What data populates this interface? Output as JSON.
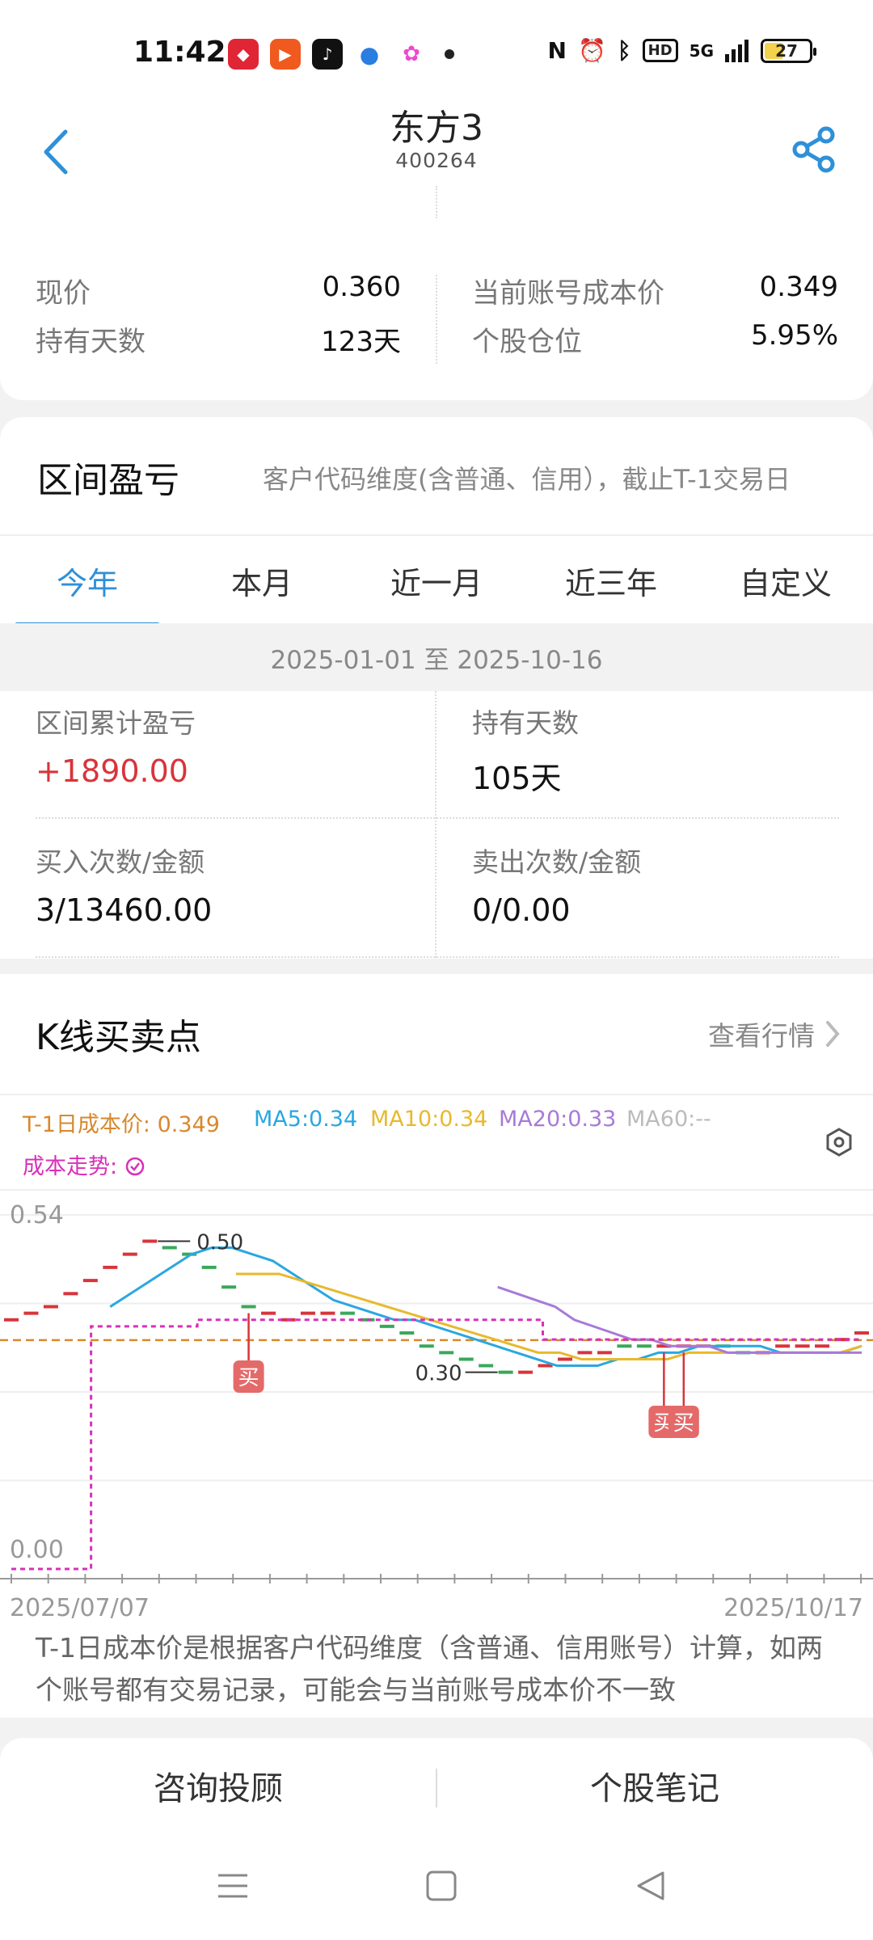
{
  "status": {
    "time": "11:42",
    "battery": "27",
    "network": "5G",
    "hd": "HD"
  },
  "header": {
    "title": "东方3",
    "code": "400264"
  },
  "summary": {
    "price_label": "现价",
    "price_value": "0.360",
    "cost_label": "当前账号成本价",
    "cost_value": "0.349",
    "days_label": "持有天数",
    "days_value": "123天",
    "position_label": "个股仓位",
    "position_value": "5.95%"
  },
  "pnl": {
    "title": "区间盈亏",
    "note": "客户代码维度(含普通、信用），截止T-1交易日",
    "tabs": [
      "今年",
      "本月",
      "近一月",
      "近三年",
      "自定义"
    ],
    "date_range": "2025-01-01 至 2025-10-16",
    "cum_label": "区间累计盈亏",
    "cum_value": "+1890.00",
    "hold_label": "持有天数",
    "hold_value": "105天",
    "buy_label": "买入次数/金额",
    "buy_value": "3/13460.00",
    "sell_label": "卖出次数/金额",
    "sell_value": "0/0.00"
  },
  "kline": {
    "title": "K线买卖点",
    "link": "查看行情",
    "legend": {
      "cost": "T-1日成本价: 0.349",
      "ma5": "MA5:0.34",
      "ma10": "MA10:0.34",
      "ma20": "MA20:0.33",
      "ma60": "MA60:--",
      "trend": "成本走势:"
    },
    "footnote": "T-1日成本价是根据客户代码维度（含普通、信用账号）计算，如两个账号都有交易记录，可能会与当前账号成本价不一致"
  },
  "colors": {
    "accent": "#2e90d8",
    "red": "#d8343b",
    "green": "#3aa85a",
    "cost": "#d8882c",
    "ma5": "#2aa7e0",
    "ma10": "#e8b92c",
    "ma20": "#a77ad8",
    "ma60": "#bbbbbb",
    "trend": "#d830b8"
  },
  "chart_data": {
    "type": "line",
    "x_start": "2025/07/07",
    "x_end": "2025/10/17",
    "ylim": [
      0.0,
      0.54
    ],
    "y_ticks": [
      "0.54",
      "0.00"
    ],
    "high_label": "0.50",
    "low_label": "0.30",
    "cost_line": 0.349,
    "buy_label": "买",
    "buy_indices": [
      12,
      33,
      34
    ],
    "candles": [
      0.38,
      0.39,
      0.4,
      0.42,
      0.44,
      0.46,
      0.48,
      0.5,
      0.49,
      0.48,
      0.46,
      0.43,
      0.4,
      0.39,
      0.38,
      0.39,
      0.39,
      0.39,
      0.38,
      0.37,
      0.36,
      0.34,
      0.33,
      0.32,
      0.31,
      0.3,
      0.3,
      0.31,
      0.32,
      0.33,
      0.33,
      0.34,
      0.34,
      0.34,
      0.34,
      0.34,
      0.34,
      0.33,
      0.33,
      0.34,
      0.34,
      0.34,
      0.35,
      0.36
    ],
    "candle_dir": [
      "r",
      "r",
      "r",
      "r",
      "r",
      "r",
      "r",
      "r",
      "g",
      "g",
      "g",
      "g",
      "g",
      "r",
      "r",
      "r",
      "r",
      "g",
      "g",
      "g",
      "g",
      "g",
      "g",
      "g",
      "g",
      "g",
      "r",
      "r",
      "r",
      "r",
      "r",
      "g",
      "g",
      "r",
      "r",
      "r",
      "g",
      "g",
      "r",
      "r",
      "r",
      "r",
      "r",
      "r"
    ],
    "series": [
      {
        "name": "MA5",
        "values": [
          0.4,
          0.42,
          0.44,
          0.46,
          0.48,
          0.49,
          0.49,
          0.48,
          0.47,
          0.45,
          0.43,
          0.41,
          0.4,
          0.39,
          0.38,
          0.38,
          0.37,
          0.36,
          0.35,
          0.34,
          0.33,
          0.32,
          0.31,
          0.31,
          0.31,
          0.32,
          0.32,
          0.33,
          0.33,
          0.34,
          0.34,
          0.34,
          0.34,
          0.33,
          0.33,
          0.33,
          0.33,
          0.34
        ]
      },
      {
        "name": "MA10",
        "values": [
          null,
          null,
          null,
          null,
          0.45,
          0.45,
          0.45,
          0.44,
          0.43,
          0.42,
          0.41,
          0.4,
          0.39,
          0.38,
          0.37,
          0.36,
          0.35,
          0.34,
          0.33,
          0.33,
          0.32,
          0.32,
          0.32,
          0.32,
          0.32,
          0.33,
          0.33,
          0.33,
          0.33,
          0.33,
          0.33,
          0.33,
          0.33,
          0.34
        ]
      },
      {
        "name": "MA20",
        "values": [
          null,
          null,
          null,
          null,
          null,
          null,
          null,
          null,
          null,
          null,
          null,
          null,
          null,
          0.43,
          0.42,
          0.41,
          0.4,
          0.38,
          0.37,
          0.36,
          0.35,
          0.35,
          0.34,
          0.34,
          0.34,
          0.33,
          0.33,
          0.33,
          0.33,
          0.33,
          0.33,
          0.33,
          0.33
        ]
      },
      {
        "name": "成本走势",
        "values": [
          0.0,
          0.0,
          0.0,
          0.37,
          0.37,
          0.37,
          0.37,
          0.38,
          0.38,
          0.38,
          0.38,
          0.38,
          0.38,
          0.38,
          0.38,
          0.38,
          0.38,
          0.38,
          0.38,
          0.38,
          0.35,
          0.35,
          0.35,
          0.35,
          0.35,
          0.35,
          0.35,
          0.35,
          0.35,
          0.35,
          0.35,
          0.35,
          0.35
        ]
      }
    ]
  },
  "bottom": {
    "consult": "咨询投顾",
    "notes": "个股笔记"
  }
}
